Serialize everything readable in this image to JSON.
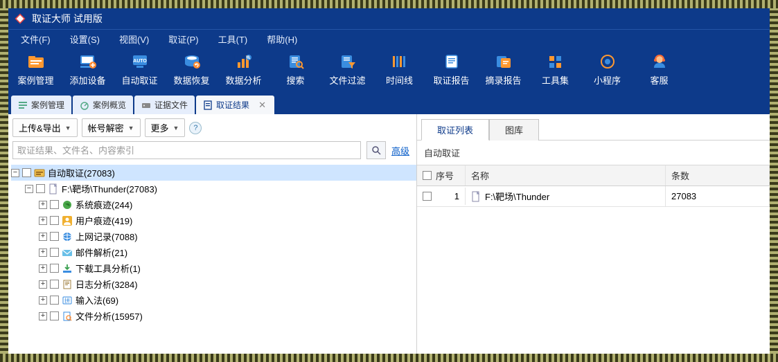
{
  "titlebar": {
    "title": "取证大师 试用版"
  },
  "menubar": [
    {
      "label": "文件(F)"
    },
    {
      "label": "设置(S)"
    },
    {
      "label": "视图(V)"
    },
    {
      "label": "取证(P)"
    },
    {
      "label": "工具(T)"
    },
    {
      "label": "帮助(H)"
    }
  ],
  "toolbar": [
    {
      "id": "case-mgmt",
      "label": "案例管理"
    },
    {
      "id": "add-device",
      "label": "添加设备"
    },
    {
      "id": "auto-forensics",
      "label": "自动取证"
    },
    {
      "id": "data-recovery",
      "label": "数据恢复"
    },
    {
      "id": "data-analysis",
      "label": "数据分析"
    },
    {
      "id": "search",
      "label": "搜索"
    },
    {
      "id": "file-filter",
      "label": "文件过滤"
    },
    {
      "id": "timeline",
      "label": "时间线"
    },
    {
      "id": "forensics-report",
      "label": "取证报告"
    },
    {
      "id": "excerpt-report",
      "label": "摘录报告"
    },
    {
      "id": "toolset",
      "label": "工具集"
    },
    {
      "id": "miniapp",
      "label": "小程序"
    },
    {
      "id": "support",
      "label": "客服"
    }
  ],
  "doc_tabs": [
    {
      "label": "案例管理",
      "icon": "list"
    },
    {
      "label": "案例概览",
      "icon": "gauge"
    },
    {
      "label": "证据文件",
      "icon": "drive"
    },
    {
      "label": "取证结果",
      "icon": "result",
      "active": true
    }
  ],
  "left": {
    "actions": {
      "upload_export": "上传&导出",
      "account_decrypt": "帐号解密",
      "more": "更多"
    },
    "search": {
      "placeholder": "取证结果、文件名、内容索引",
      "advanced": "高级"
    },
    "tree": [
      {
        "depth": 0,
        "exp": "-",
        "icon": "auto",
        "label": "自动取证(27083)",
        "selected": true
      },
      {
        "depth": 1,
        "exp": "-",
        "icon": "file",
        "label": "F:\\靶场\\Thunder(27083)"
      },
      {
        "depth": 2,
        "exp": "+",
        "icon": "globe",
        "label": "系统痕迹(244)"
      },
      {
        "depth": 2,
        "exp": "+",
        "icon": "user",
        "label": "用户痕迹(419)"
      },
      {
        "depth": 2,
        "exp": "+",
        "icon": "net",
        "label": "上网记录(7088)"
      },
      {
        "depth": 2,
        "exp": "+",
        "icon": "mail",
        "label": "邮件解析(21)"
      },
      {
        "depth": 2,
        "exp": "+",
        "icon": "download",
        "label": "下载工具分析(1)"
      },
      {
        "depth": 2,
        "exp": "+",
        "icon": "log",
        "label": "日志分析(3284)"
      },
      {
        "depth": 2,
        "exp": "+",
        "icon": "ime",
        "label": "输入法(69)"
      },
      {
        "depth": 2,
        "exp": "+",
        "icon": "fanalysis",
        "label": "文件分析(15957)"
      }
    ]
  },
  "right": {
    "tabs": [
      {
        "label": "取证列表",
        "active": true
      },
      {
        "label": "图库"
      }
    ],
    "subtitle": "自动取证",
    "grid": {
      "headers": {
        "idx": "序号",
        "name": "名称",
        "count": "条数"
      },
      "rows": [
        {
          "idx": "1",
          "name": "F:\\靶场\\Thunder",
          "count": "27083"
        }
      ]
    }
  }
}
